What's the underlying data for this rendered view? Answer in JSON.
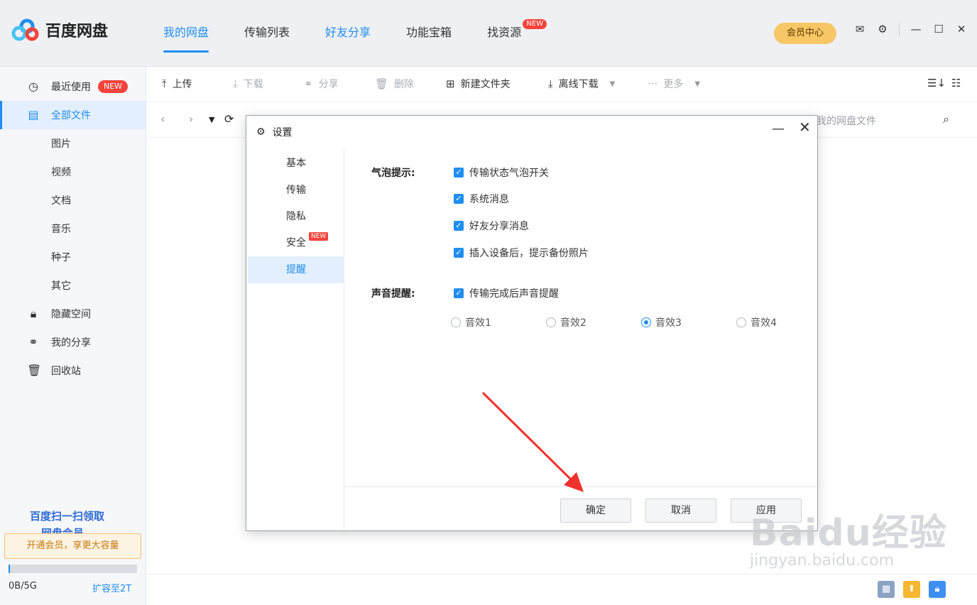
{
  "app": {
    "name": "百度网盘",
    "nav": [
      {
        "label": "我的网盘"
      },
      {
        "label": "传输列表"
      },
      {
        "label": "好友分享"
      },
      {
        "label": "功能宝箱"
      },
      {
        "label": "找资源",
        "badge": "NEW"
      }
    ],
    "vip_label": "会员中心"
  },
  "sidebar": {
    "items": [
      {
        "label": "最近使用",
        "badge": "NEW",
        "icon": "clock-icon"
      },
      {
        "label": "全部文件",
        "icon": "file-icon"
      },
      {
        "label": "图片"
      },
      {
        "label": "视频"
      },
      {
        "label": "文档"
      },
      {
        "label": "音乐"
      },
      {
        "label": "种子"
      },
      {
        "label": "其它"
      },
      {
        "label": "隐藏空间",
        "icon": "lock-icon"
      },
      {
        "label": "我的分享",
        "icon": "share-icon"
      },
      {
        "label": "回收站",
        "icon": "trash-icon"
      }
    ],
    "promo_line1": "百度扫一扫领取",
    "promo_line2": "网盘会员",
    "upgrade_label": "开通会员，享更大容量",
    "quota_text": "0B/5G",
    "quota_fraction": 0.01,
    "expand_label": "扩容至2T"
  },
  "toolbar": {
    "upload": "上传",
    "download": "下载",
    "share": "分享",
    "delete": "删除",
    "new_folder": "新建文件夹",
    "offline_download": "离线下载",
    "more": "更多"
  },
  "search": {
    "placeholder": "我的网盘文件"
  },
  "dialog": {
    "title": "设置",
    "menu": [
      {
        "label": "基本"
      },
      {
        "label": "传输"
      },
      {
        "label": "隐私"
      },
      {
        "label": "安全",
        "badge": "NEW"
      },
      {
        "label": "提醒"
      }
    ],
    "bubble_label": "气泡提示:",
    "bubble_options": [
      {
        "label": "传输状态气泡开关",
        "checked": true
      },
      {
        "label": "系统消息",
        "checked": true
      },
      {
        "label": "好友分享消息",
        "checked": true
      },
      {
        "label": "插入设备后，提示备份照片",
        "checked": true
      }
    ],
    "sound_label": "声音提醒:",
    "sound_option": {
      "label": "传输完成后声音提醒",
      "checked": true
    },
    "sound_effects": [
      {
        "label": "音效1",
        "selected": false
      },
      {
        "label": "音效2",
        "selected": false
      },
      {
        "label": "音效3",
        "selected": true
      },
      {
        "label": "音效4",
        "selected": false
      }
    ],
    "ok": "确定",
    "cancel": "取消",
    "apply": "应用"
  },
  "watermark": {
    "line1": "Baidu经验",
    "line2": "jingyan.baidu.com"
  },
  "colors": {
    "accent": "#1f8ef1",
    "badge": "#f5433b",
    "vip": "#f7c766"
  }
}
